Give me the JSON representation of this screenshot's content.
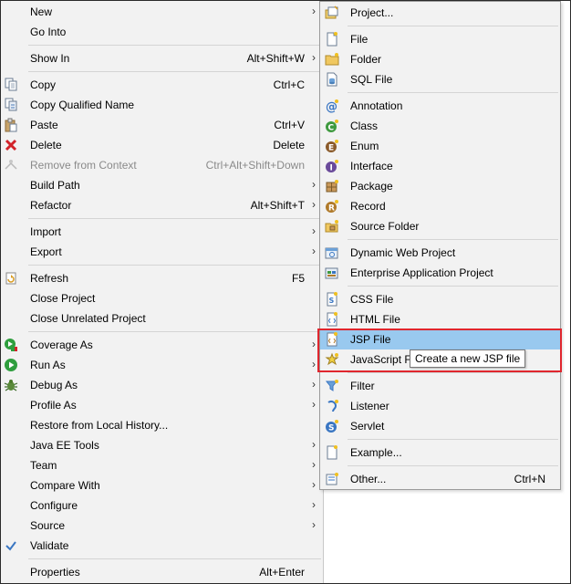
{
  "main_menu": {
    "items": [
      {
        "id": "new",
        "label": "New",
        "shortcut": "",
        "submenu": true,
        "icon": "none"
      },
      {
        "id": "go-into",
        "label": "Go Into",
        "shortcut": "",
        "submenu": false,
        "icon": "none"
      },
      {
        "id": "show-in",
        "label": "Show In",
        "shortcut": "Alt+Shift+W",
        "submenu": true,
        "icon": "none"
      },
      {
        "id": "copy",
        "label": "Copy",
        "shortcut": "Ctrl+C",
        "submenu": false,
        "icon": "copy-icon"
      },
      {
        "id": "copy-qualified-name",
        "label": "Copy Qualified Name",
        "shortcut": "",
        "submenu": false,
        "icon": "copy-qualified-icon"
      },
      {
        "id": "paste",
        "label": "Paste",
        "shortcut": "Ctrl+V",
        "submenu": false,
        "icon": "paste-icon"
      },
      {
        "id": "delete",
        "label": "Delete",
        "shortcut": "Delete",
        "submenu": false,
        "icon": "delete-icon"
      },
      {
        "id": "remove-from-context",
        "label": "Remove from Context",
        "shortcut": "Ctrl+Alt+Shift+Down",
        "submenu": false,
        "icon": "remove-context-icon",
        "disabled": true
      },
      {
        "id": "build-path",
        "label": "Build Path",
        "shortcut": "",
        "submenu": true,
        "icon": "none"
      },
      {
        "id": "refactor",
        "label": "Refactor",
        "shortcut": "Alt+Shift+T",
        "submenu": true,
        "icon": "none"
      },
      {
        "id": "import",
        "label": "Import",
        "shortcut": "",
        "submenu": true,
        "icon": "none"
      },
      {
        "id": "export",
        "label": "Export",
        "shortcut": "",
        "submenu": true,
        "icon": "none"
      },
      {
        "id": "refresh",
        "label": "Refresh",
        "shortcut": "F5",
        "submenu": false,
        "icon": "refresh-icon"
      },
      {
        "id": "close-project",
        "label": "Close Project",
        "shortcut": "",
        "submenu": false,
        "icon": "none"
      },
      {
        "id": "close-unrelated-project",
        "label": "Close Unrelated Project",
        "shortcut": "",
        "submenu": false,
        "icon": "none"
      },
      {
        "id": "coverage-as",
        "label": "Coverage As",
        "shortcut": "",
        "submenu": true,
        "icon": "coverage-icon"
      },
      {
        "id": "run-as",
        "label": "Run As",
        "shortcut": "",
        "submenu": true,
        "icon": "run-icon"
      },
      {
        "id": "debug-as",
        "label": "Debug As",
        "shortcut": "",
        "submenu": true,
        "icon": "debug-icon"
      },
      {
        "id": "profile-as",
        "label": "Profile As",
        "shortcut": "",
        "submenu": true,
        "icon": "none"
      },
      {
        "id": "restore-local-history",
        "label": "Restore from Local History...",
        "shortcut": "",
        "submenu": false,
        "icon": "none"
      },
      {
        "id": "java-ee-tools",
        "label": "Java EE Tools",
        "shortcut": "",
        "submenu": true,
        "icon": "none"
      },
      {
        "id": "team",
        "label": "Team",
        "shortcut": "",
        "submenu": true,
        "icon": "none"
      },
      {
        "id": "compare-with",
        "label": "Compare With",
        "shortcut": "",
        "submenu": true,
        "icon": "none"
      },
      {
        "id": "configure",
        "label": "Configure",
        "shortcut": "",
        "submenu": true,
        "icon": "none"
      },
      {
        "id": "source",
        "label": "Source",
        "shortcut": "",
        "submenu": true,
        "icon": "none"
      },
      {
        "id": "validate",
        "label": "Validate",
        "shortcut": "",
        "submenu": false,
        "icon": "checkmark-icon"
      },
      {
        "id": "properties",
        "label": "Properties",
        "shortcut": "Alt+Enter",
        "submenu": false,
        "icon": "none"
      }
    ]
  },
  "sub_menu": {
    "items": [
      {
        "id": "project",
        "label": "Project...",
        "shortcut": "",
        "icon": "project-icon"
      },
      {
        "id": "file",
        "label": "File",
        "shortcut": "",
        "icon": "file-icon"
      },
      {
        "id": "folder",
        "label": "Folder",
        "shortcut": "",
        "icon": "folder-icon"
      },
      {
        "id": "sql-file",
        "label": "SQL File",
        "shortcut": "",
        "icon": "sql-file-icon"
      },
      {
        "id": "annotation",
        "label": "Annotation",
        "shortcut": "",
        "icon": "annotation-icon"
      },
      {
        "id": "class",
        "label": "Class",
        "shortcut": "",
        "icon": "class-icon"
      },
      {
        "id": "enum",
        "label": "Enum",
        "shortcut": "",
        "icon": "enum-icon"
      },
      {
        "id": "interface",
        "label": "Interface",
        "shortcut": "",
        "icon": "interface-icon"
      },
      {
        "id": "package",
        "label": "Package",
        "shortcut": "",
        "icon": "package-icon"
      },
      {
        "id": "record",
        "label": "Record",
        "shortcut": "",
        "icon": "record-icon"
      },
      {
        "id": "source-folder",
        "label": "Source Folder",
        "shortcut": "",
        "icon": "source-folder-icon"
      },
      {
        "id": "dynamic-web-project",
        "label": "Dynamic Web Project",
        "shortcut": "",
        "icon": "web-project-icon"
      },
      {
        "id": "enterprise-app-project",
        "label": "Enterprise Application Project",
        "shortcut": "",
        "icon": "enterprise-project-icon"
      },
      {
        "id": "css-file",
        "label": "CSS File",
        "shortcut": "",
        "icon": "css-file-icon"
      },
      {
        "id": "html-file",
        "label": "HTML File",
        "shortcut": "",
        "icon": "html-file-icon"
      },
      {
        "id": "jsp-file",
        "label": "JSP File",
        "shortcut": "",
        "icon": "jsp-file-icon",
        "selected": true
      },
      {
        "id": "javascript-file",
        "label": "JavaScript F",
        "shortcut": "",
        "icon": "javascript-file-icon"
      },
      {
        "id": "filter",
        "label": "Filter",
        "shortcut": "",
        "icon": "filter-icon"
      },
      {
        "id": "listener",
        "label": "Listener",
        "shortcut": "",
        "icon": "listener-icon"
      },
      {
        "id": "servlet",
        "label": "Servlet",
        "shortcut": "",
        "icon": "servlet-icon"
      },
      {
        "id": "example",
        "label": "Example...",
        "shortcut": "",
        "icon": "example-icon"
      },
      {
        "id": "other",
        "label": "Other...",
        "shortcut": "Ctrl+N",
        "icon": "other-icon"
      }
    ]
  },
  "tooltip": {
    "text": "Create a new JSP file"
  },
  "arrow_glyph": "›",
  "colors": {
    "menu_bg": "#f2f2f2",
    "selected_bg": "#99c9ef",
    "highlight_border": "#e0262e",
    "disabled_text": "#8a8a8a"
  }
}
